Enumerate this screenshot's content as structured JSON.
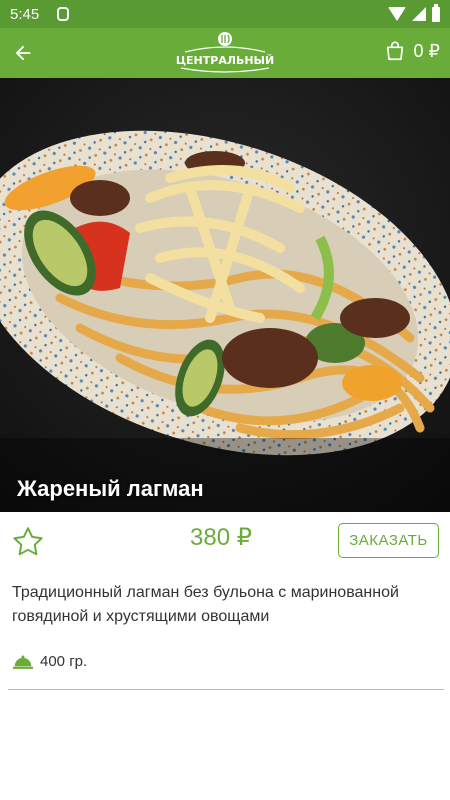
{
  "status_bar": {
    "time": "5:45",
    "icons": [
      "notification-icon",
      "wifi-icon",
      "signal-icon",
      "battery-icon"
    ]
  },
  "app_bar": {
    "back_icon": "arrow-left-icon",
    "logo_text": "ЦЕНТРАЛЬНЫЙ",
    "cart_icon": "shopping-bag-icon",
    "cart_total": "0 ₽",
    "color": "#6aac3a"
  },
  "product": {
    "title": "Жареный лагман",
    "price": "380 ₽",
    "order_label": "ЗАКАЗАТЬ",
    "favorite_icon": "star-outline-icon",
    "description": "Традиционный лагман без бульона с маринованной говядиной и хрустящими овощами",
    "weight": "400 гр.",
    "weight_icon": "cloche-icon",
    "accent_color": "#6aac3a"
  }
}
